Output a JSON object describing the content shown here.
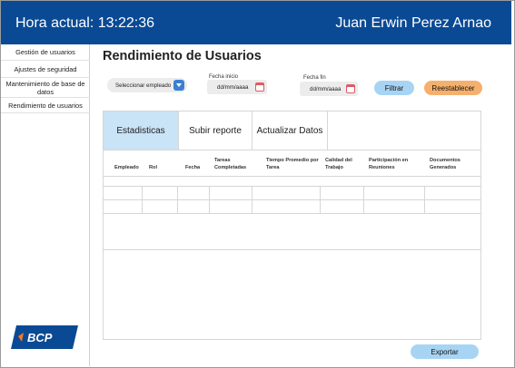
{
  "header": {
    "clock": "Hora actual: 13:22:36",
    "user_name": "Juan Erwin Perez Arnao"
  },
  "sidebar": {
    "items": [
      {
        "label": "Gestión de usuarios"
      },
      {
        "label": "Ajustes de seguridad"
      },
      {
        "label": "Mantenimiento de base de datos"
      },
      {
        "label": "Rendimiento de usuarios"
      }
    ]
  },
  "logo": {
    "text": "BCP",
    "color": "#0a4a95",
    "accent": "#f47b20"
  },
  "page": {
    "title": "Rendimiento de Usuarios"
  },
  "filters": {
    "employee_select": "Seleccionar empleado",
    "start_label": "Fecha inicio",
    "start_value": "dd/mm/aaaa",
    "end_label": "Fecha fin",
    "end_value": "dd/mm/aaaa",
    "filter_button": "Filtrar",
    "reset_button": "Reestablecer"
  },
  "tabs": [
    {
      "label": "Estadisticas",
      "active": true
    },
    {
      "label": "Subir reporte",
      "active": false
    },
    {
      "label": "Actualizar Datos",
      "active": false
    }
  ],
  "table": {
    "columns": [
      "Empleado",
      "Rol",
      "Fecha",
      "Tareas Completadas",
      "Tiempo Promedio por Tarea",
      "Calidad del Trabajo",
      "Participación en Reuniones",
      "Documentos Generados"
    ],
    "rows": []
  },
  "export_button": "Exportar",
  "colors": {
    "header_bg": "#0a4a95",
    "active_tab": "#c9e3f7",
    "filter_button": "#a8d4f3",
    "reset_button": "#f6b06d",
    "calendar_icon": "#e05a63",
    "dropdown_icon": "#3b7fd4"
  },
  "icons": {
    "dropdown": "chevron-down-icon",
    "calendar": "calendar-icon"
  }
}
